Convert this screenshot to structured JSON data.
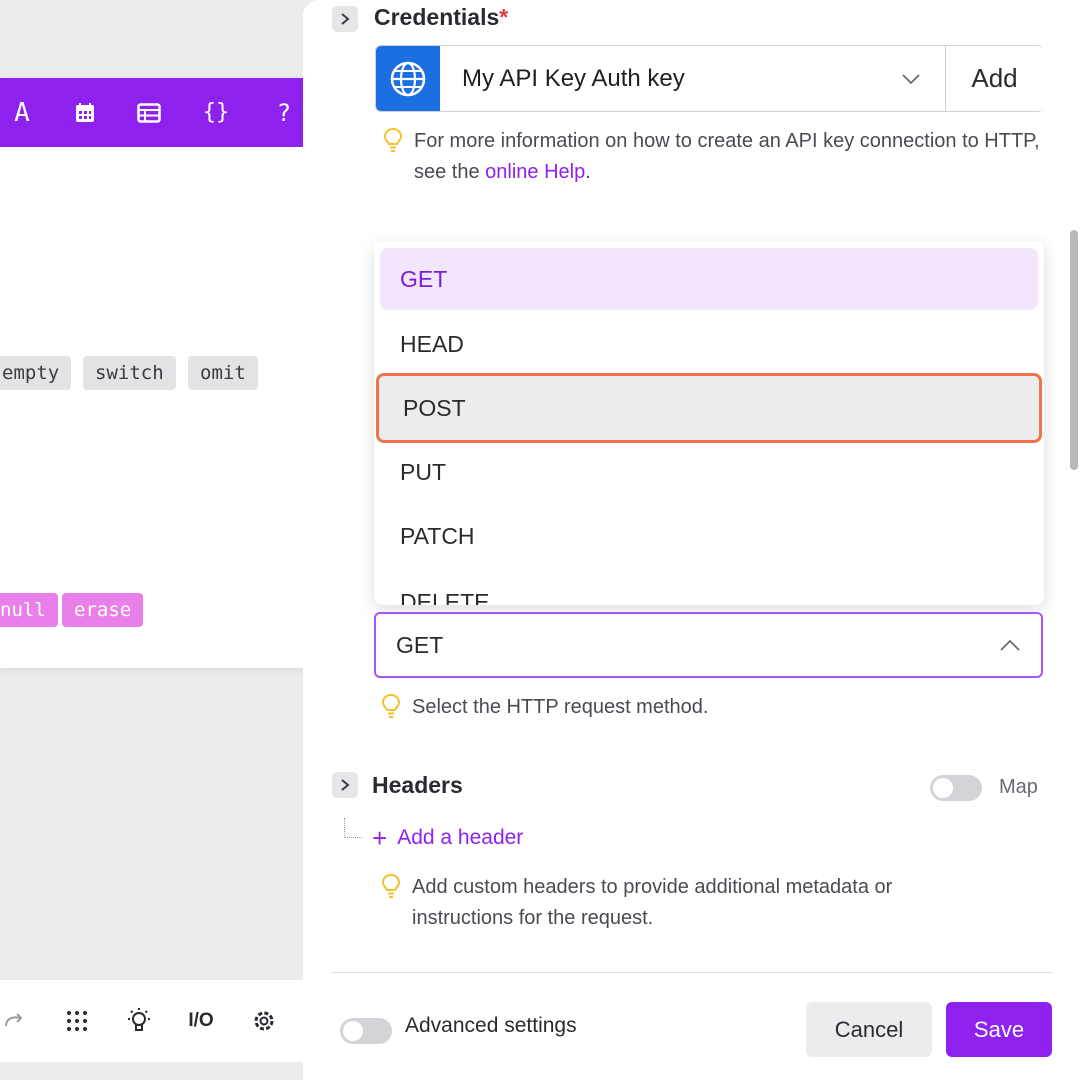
{
  "mapping_panel": {
    "toolbar_icons": [
      "text-icon",
      "calendar-icon",
      "table-icon",
      "braces-icon",
      "help-icon",
      "close-icon"
    ],
    "toolbar_text": {
      "text": "A",
      "braces": "{}",
      "help": "?",
      "close": "✕"
    },
    "gray_chips": [
      "empty",
      "switch",
      "omit"
    ],
    "pink_chips": [
      "null",
      "erase"
    ]
  },
  "bottom_toolbar": {
    "icons": [
      "redo-icon",
      "grid-dots-icon",
      "bulb-icon",
      "io-icon",
      "settings-icon"
    ],
    "io_label": "I/O"
  },
  "credentials": {
    "title": "Credentials",
    "required_mark": "*",
    "selected": "My API Key Auth key",
    "add_label": "Add",
    "hint_prefix": "For more information on how to create an API key connection to HTTP, see the ",
    "hint_link": "online Help",
    "hint_suffix": "."
  },
  "method": {
    "options": [
      "GET",
      "HEAD",
      "POST",
      "PUT",
      "PATCH",
      "DELETE"
    ],
    "selected_option": "GET",
    "hovered_option": "POST",
    "value": "GET",
    "hint": "Select the HTTP request method."
  },
  "headers": {
    "title": "Headers",
    "map_label": "Map",
    "map_enabled": false,
    "add_label": "Add a header",
    "hint": "Add custom headers to provide additional metadata or instructions for the request."
  },
  "footer": {
    "advanced_label": "Advanced settings",
    "advanced_enabled": false,
    "cancel_label": "Cancel",
    "save_label": "Save"
  },
  "colors": {
    "accent": "#8f21ef",
    "pink": "#e980ea",
    "globe": "#1c6fe0",
    "hover_outline": "#f0734a",
    "required": "#e23b3b"
  }
}
